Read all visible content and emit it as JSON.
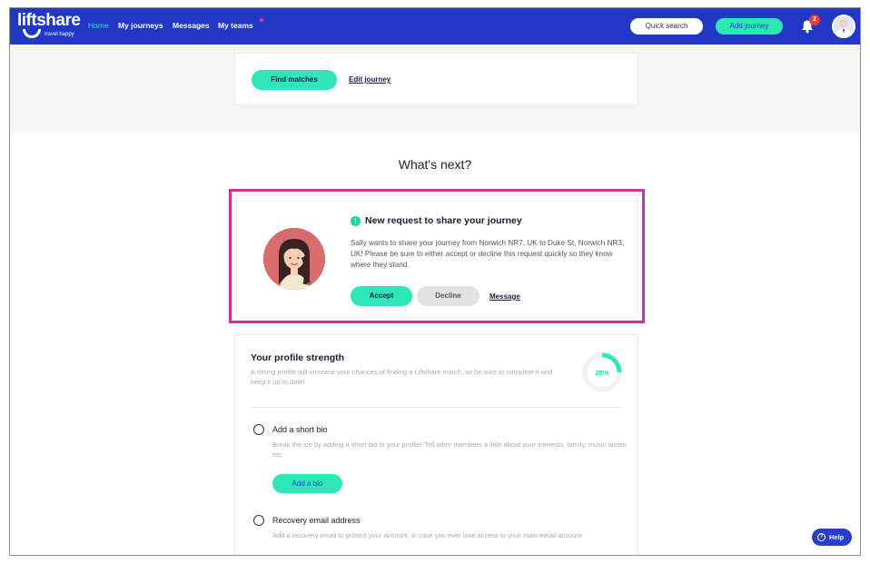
{
  "nav": {
    "logo": {
      "name": "liftshare",
      "tagline": "travel happy"
    },
    "links": [
      "Home",
      "My journeys",
      "Messages",
      "My teams"
    ],
    "quick_search": "Quick search",
    "add_journey": "Add journey",
    "notification_count": "2"
  },
  "journey_actions": {
    "find_matches": "Find matches",
    "edit_journey": "Edit journey"
  },
  "whats_next": "What's next?",
  "request": {
    "icon": "!",
    "title": "New request to share your journey",
    "body": "Sally wants to share your journey from Norwich NR7, UK to Duke St, Norwich NR3, UK! Please be sure to either accept or decline this request quickly so they know where they stand.",
    "accept": "Accept",
    "decline": "Decline",
    "message": "Message"
  },
  "profile": {
    "title": "Your profile strength",
    "subtitle": "A strong profile will increase your chances of finding a Liftshare match, so be sure to complete it and keep it up to date!",
    "strength_percent": "25%",
    "strength_value": 0.25,
    "items": [
      {
        "title": "Add a short bio",
        "description": "Break the ice by adding a short bio to your profile! Tell other members a little about your interests, family, music tastes etc.",
        "button": "Add a bio"
      },
      {
        "title": "Recovery email address",
        "description": "Add a recovery email to protect your account, in case you ever lose access to your main email account"
      }
    ]
  },
  "help": {
    "icon": "?",
    "label": "Help"
  },
  "colors": {
    "nav_bg": "#2137c6",
    "accent": "#2ee6b8",
    "highlight_border": "#d23297",
    "badge": "#ee3a3a"
  }
}
